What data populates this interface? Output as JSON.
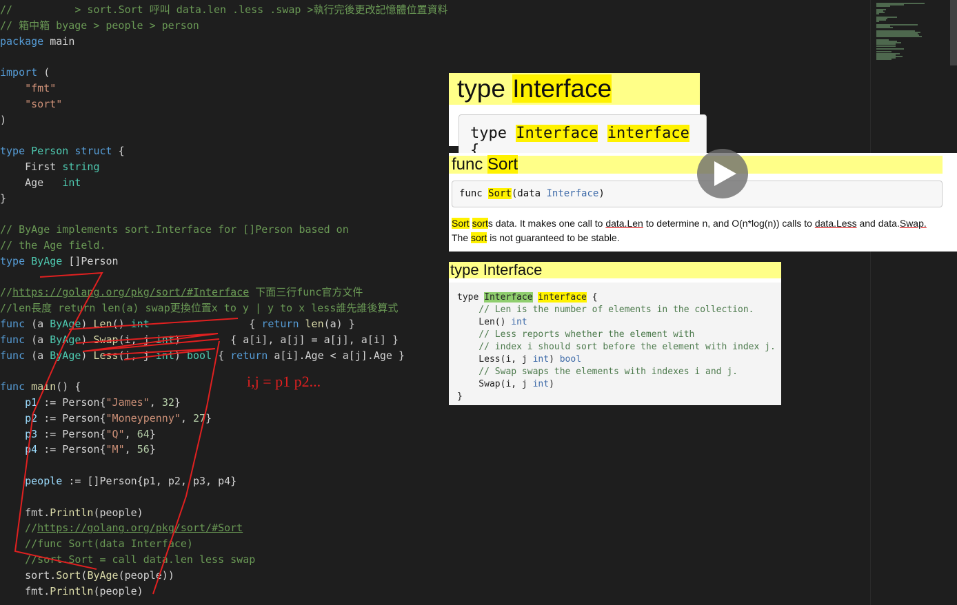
{
  "code": [
    {
      "parts": [
        {
          "c": "com",
          "t": "//          > sort.Sort 呼叫 data.len .less .swap >執行完後更改記憶體位置資料"
        }
      ]
    },
    {
      "parts": [
        {
          "c": "com",
          "t": "// 箱中箱 byage > people > person"
        }
      ]
    },
    {
      "parts": [
        {
          "c": "kw",
          "t": "package"
        },
        {
          "c": "",
          "t": " main"
        }
      ]
    },
    {
      "parts": []
    },
    {
      "parts": [
        {
          "c": "kw",
          "t": "import"
        },
        {
          "c": "",
          "t": " ("
        }
      ]
    },
    {
      "parts": [
        {
          "c": "",
          "t": "    "
        },
        {
          "c": "str",
          "t": "\"fmt\""
        }
      ]
    },
    {
      "parts": [
        {
          "c": "",
          "t": "    "
        },
        {
          "c": "str",
          "t": "\"sort\""
        }
      ]
    },
    {
      "parts": [
        {
          "c": "",
          "t": ")"
        }
      ]
    },
    {
      "parts": []
    },
    {
      "parts": [
        {
          "c": "kw",
          "t": "type"
        },
        {
          "c": "",
          "t": " "
        },
        {
          "c": "typ",
          "t": "Person"
        },
        {
          "c": "",
          "t": " "
        },
        {
          "c": "kw",
          "t": "struct"
        },
        {
          "c": "",
          "t": " {"
        }
      ]
    },
    {
      "parts": [
        {
          "c": "",
          "t": "    First "
        },
        {
          "c": "typ",
          "t": "string"
        }
      ]
    },
    {
      "parts": [
        {
          "c": "",
          "t": "    Age   "
        },
        {
          "c": "typ",
          "t": "int"
        }
      ]
    },
    {
      "parts": [
        {
          "c": "",
          "t": "}"
        }
      ]
    },
    {
      "parts": []
    },
    {
      "parts": [
        {
          "c": "com",
          "t": "// ByAge implements sort.Interface for []Person based on"
        }
      ]
    },
    {
      "parts": [
        {
          "c": "com",
          "t": "// the Age field."
        }
      ]
    },
    {
      "parts": [
        {
          "c": "kw",
          "t": "type"
        },
        {
          "c": "",
          "t": " "
        },
        {
          "c": "typ",
          "t": "ByAge"
        },
        {
          "c": "",
          "t": " []Person"
        }
      ]
    },
    {
      "parts": []
    },
    {
      "parts": [
        {
          "c": "com",
          "t": "//"
        },
        {
          "c": "com link",
          "t": "https://golang.org/pkg/sort/#Interface"
        },
        {
          "c": "com",
          "t": " 下面三行func官方文件"
        }
      ]
    },
    {
      "parts": [
        {
          "c": "com",
          "t": "//len長度 return len(a) swap更換位置x to y | y to x less誰先誰後算式"
        }
      ]
    },
    {
      "parts": [
        {
          "c": "kw",
          "t": "func"
        },
        {
          "c": "",
          "t": " (a "
        },
        {
          "c": "typ",
          "t": "ByAge"
        },
        {
          "c": "",
          "t": ") "
        },
        {
          "c": "fn",
          "t": "Len"
        },
        {
          "c": "",
          "t": "() "
        },
        {
          "c": "typ",
          "t": "int"
        },
        {
          "c": "",
          "t": "                { "
        },
        {
          "c": "kw",
          "t": "return"
        },
        {
          "c": "",
          "t": " "
        },
        {
          "c": "fn",
          "t": "len"
        },
        {
          "c": "",
          "t": "(a) }"
        }
      ]
    },
    {
      "parts": [
        {
          "c": "kw",
          "t": "func"
        },
        {
          "c": "",
          "t": " (a "
        },
        {
          "c": "typ",
          "t": "ByAge"
        },
        {
          "c": "",
          "t": ") "
        },
        {
          "c": "fn",
          "t": "Swap"
        },
        {
          "c": "",
          "t": "(i, j "
        },
        {
          "c": "typ",
          "t": "int"
        },
        {
          "c": "",
          "t": ")        { a[i], a[j] = a[j], a[i] }"
        }
      ]
    },
    {
      "parts": [
        {
          "c": "kw",
          "t": "func"
        },
        {
          "c": "",
          "t": " (a "
        },
        {
          "c": "typ",
          "t": "ByAge"
        },
        {
          "c": "",
          "t": ") "
        },
        {
          "c": "fn",
          "t": "Less"
        },
        {
          "c": "",
          "t": "(i, j "
        },
        {
          "c": "typ",
          "t": "int"
        },
        {
          "c": "",
          "t": ") "
        },
        {
          "c": "typ",
          "t": "bool"
        },
        {
          "c": "",
          "t": " { "
        },
        {
          "c": "kw",
          "t": "return"
        },
        {
          "c": "",
          "t": " a[i].Age < a[j].Age }"
        }
      ]
    },
    {
      "parts": []
    },
    {
      "parts": [
        {
          "c": "kw",
          "t": "func"
        },
        {
          "c": "",
          "t": " "
        },
        {
          "c": "fn",
          "t": "main"
        },
        {
          "c": "",
          "t": "() {"
        }
      ]
    },
    {
      "parts": [
        {
          "c": "",
          "t": "    "
        },
        {
          "c": "var",
          "t": "p1"
        },
        {
          "c": "",
          "t": " := Person{"
        },
        {
          "c": "str",
          "t": "\"James\""
        },
        {
          "c": "",
          "t": ", "
        },
        {
          "c": "num",
          "t": "32"
        },
        {
          "c": "",
          "t": "}"
        }
      ]
    },
    {
      "parts": [
        {
          "c": "",
          "t": "    "
        },
        {
          "c": "var",
          "t": "p2"
        },
        {
          "c": "",
          "t": " := Person{"
        },
        {
          "c": "str",
          "t": "\"Moneypenny\""
        },
        {
          "c": "",
          "t": ", "
        },
        {
          "c": "num",
          "t": "27"
        },
        {
          "c": "",
          "t": "}"
        }
      ]
    },
    {
      "parts": [
        {
          "c": "",
          "t": "    "
        },
        {
          "c": "var",
          "t": "p3"
        },
        {
          "c": "",
          "t": " := Person{"
        },
        {
          "c": "str",
          "t": "\"Q\""
        },
        {
          "c": "",
          "t": ", "
        },
        {
          "c": "num",
          "t": "64"
        },
        {
          "c": "",
          "t": "}"
        }
      ]
    },
    {
      "parts": [
        {
          "c": "",
          "t": "    "
        },
        {
          "c": "var",
          "t": "p4"
        },
        {
          "c": "",
          "t": " := Person{"
        },
        {
          "c": "str",
          "t": "\"M\""
        },
        {
          "c": "",
          "t": ", "
        },
        {
          "c": "num",
          "t": "56"
        },
        {
          "c": "",
          "t": "}"
        }
      ]
    },
    {
      "parts": []
    },
    {
      "parts": [
        {
          "c": "",
          "t": "    "
        },
        {
          "c": "var",
          "t": "people"
        },
        {
          "c": "",
          "t": " := []Person{p1, p2, p3, p4}"
        }
      ]
    },
    {
      "parts": []
    },
    {
      "parts": [
        {
          "c": "",
          "t": "    fmt."
        },
        {
          "c": "fn",
          "t": "Println"
        },
        {
          "c": "",
          "t": "(people)"
        }
      ]
    },
    {
      "parts": [
        {
          "c": "com",
          "t": "    //"
        },
        {
          "c": "com link",
          "t": "https://golang.org/pkg/sort/#Sort"
        }
      ]
    },
    {
      "parts": [
        {
          "c": "com",
          "t": "    //func Sort(data Interface)"
        }
      ]
    },
    {
      "parts": [
        {
          "c": "com",
          "t": "    //sort.Sort = call data.len less swap"
        }
      ]
    },
    {
      "parts": [
        {
          "c": "",
          "t": "    sort."
        },
        {
          "c": "fn",
          "t": "Sort"
        },
        {
          "c": "",
          "t": "("
        },
        {
          "c": "fn",
          "t": "ByAge"
        },
        {
          "c": "",
          "t": "(people))"
        }
      ]
    },
    {
      "parts": [
        {
          "c": "",
          "t": "    fmt."
        },
        {
          "c": "fn",
          "t": "Println"
        },
        {
          "c": "",
          "t": "(people)"
        }
      ]
    }
  ],
  "annotation": "i,j = p1 p2...",
  "panel1": {
    "title_a": "type ",
    "title_b": "Interface",
    "code_a": "type ",
    "code_b": "Interface",
    "code_c": "interface",
    "code_d": " {"
  },
  "panel2": {
    "title_a": "func ",
    "title_b": "Sort",
    "sig_a": "func ",
    "sig_b": "Sort",
    "sig_c": "(data ",
    "sig_d": "Interface",
    "sig_e": ")",
    "d1": "Sort",
    "d2": "sort",
    "d3": "s data. It makes one call to ",
    "d4": "data.Len",
    "d5": " to determine n, and O(n*log(n)) calls to ",
    "d6": "data.Less",
    "d7": " and data.",
    "d8": "Swap.",
    "d9": "The ",
    "d10": "sort",
    "d11": " is not guaranteed to be stable."
  },
  "panel3": {
    "title_a": "type ",
    "title_b": "Interface",
    "r1a": "type ",
    "r1b": "Interface",
    "r1c": "interface",
    "r1d": " {",
    "r2": "    // Len is the number of elements in the collection.",
    "r3a": "    Len() ",
    "r3b": "int",
    "r4": "    // Less reports whether the element with",
    "r5": "    // index i should sort before the element with index j.",
    "r6a": "    Less(i, j ",
    "r6b": "int",
    "r6c": ") ",
    "r6d": "bool",
    "r7": "    // Swap swaps the elements with indexes i and j.",
    "r8a": "    Swap(i, j ",
    "r8b": "int",
    "r8c": ")",
    "r9": "}"
  }
}
